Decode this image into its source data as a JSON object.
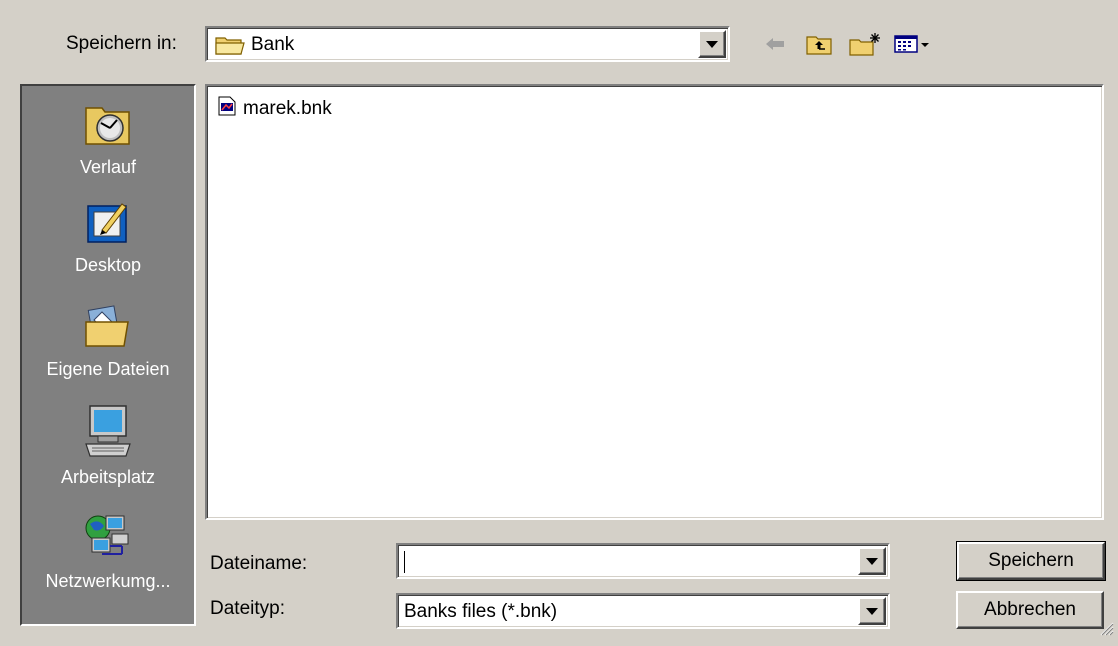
{
  "lookin": {
    "label": "Speichern in:",
    "value": "Bank",
    "icon": "folder-icon"
  },
  "toolbar": {
    "back_icon": "back-arrow-icon",
    "up_icon": "up-folder-icon",
    "new_folder_icon": "new-folder-icon",
    "view_icon": "view-menu-icon"
  },
  "places": [
    {
      "label": "Verlauf",
      "icon": "history-icon"
    },
    {
      "label": "Desktop",
      "icon": "desktop-icon"
    },
    {
      "label": "Eigene Dateien",
      "icon": "my-documents-icon"
    },
    {
      "label": "Arbeitsplatz",
      "icon": "my-computer-icon"
    },
    {
      "label": "Netzwerkumg...",
      "icon": "network-icon"
    }
  ],
  "files": [
    {
      "name": "marek.bnk",
      "icon": "bnk-file-icon"
    }
  ],
  "filename": {
    "label": "Dateiname:",
    "value": ""
  },
  "filetype": {
    "label": "Dateityp:",
    "value": "Banks files (*.bnk)"
  },
  "buttons": {
    "save": "Speichern",
    "cancel": "Abbrechen"
  },
  "colors": {
    "face": "#d4d0c8",
    "places_bg": "#808080",
    "folder_yellow": "#f0d070"
  }
}
